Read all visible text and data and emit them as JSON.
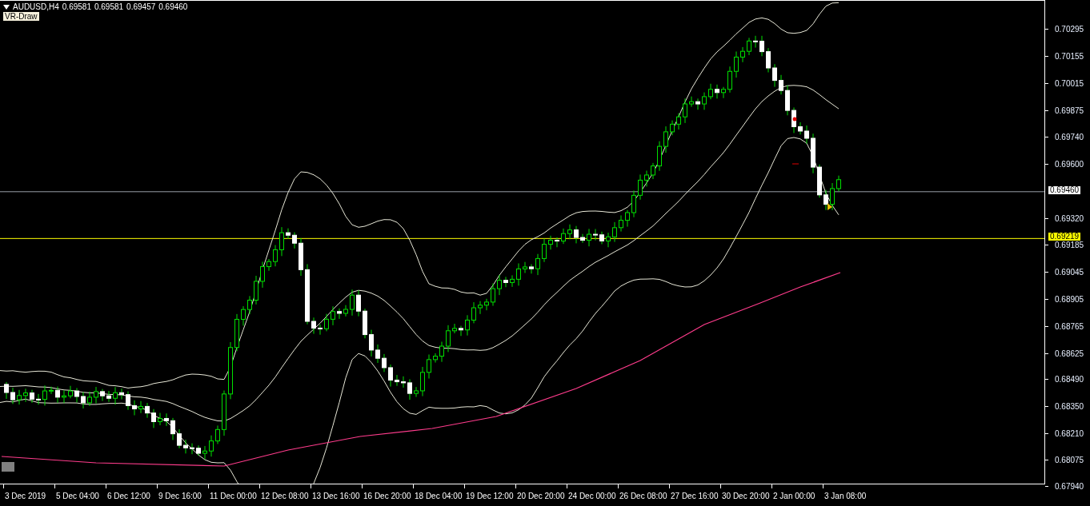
{
  "chart": {
    "symbol": "AUDUSD,H4",
    "ohlc": [
      "0.69581",
      "0.69581",
      "0.69457",
      "0.69460"
    ],
    "indicator_label": "VR-Draw"
  },
  "price_axis": {
    "ticks": [
      "0.70295",
      "0.70155",
      "0.70015",
      "0.69875",
      "0.69740",
      "0.69600",
      "0.69320",
      "0.69185",
      "0.69045",
      "0.68905",
      "0.68765",
      "0.68625",
      "0.68490",
      "0.68350",
      "0.68210",
      "0.68075",
      "0.67940"
    ]
  },
  "price_markers": [
    {
      "label": "0.69460",
      "color": "#ffffff"
    },
    {
      "label": "0.69219",
      "color": "#ffff00"
    }
  ],
  "time_axis": {
    "labels": [
      "3 Dec 2019",
      "5 Dec 04:00",
      "6 Dec 12:00",
      "9 Dec 16:00",
      "11 Dec 00:00",
      "12 Dec 08:00",
      "13 Dec 16:00",
      "16 Dec 20:00",
      "18 Dec 04:00",
      "19 Dec 12:00",
      "20 Dec 20:00",
      "24 Dec 00:00",
      "26 Dec 08:00",
      "27 Dec 16:00",
      "30 Dec 20:00",
      "2 Jan 00:00",
      "3 Jan 08:00"
    ]
  }
}
